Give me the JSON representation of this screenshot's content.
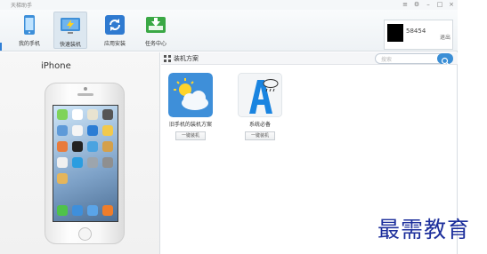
{
  "window": {
    "title": "天梯助手",
    "controls": [
      "≡",
      "⚙",
      "–",
      "□",
      "×"
    ]
  },
  "toolbar": {
    "items": [
      {
        "label": "我的手机",
        "icon": "phone-icon"
      },
      {
        "label": "快速装机",
        "icon": "lightning-icon"
      },
      {
        "label": "应用安装",
        "icon": "refresh-icon"
      },
      {
        "label": "任务中心",
        "icon": "download-icon"
      }
    ],
    "active_index": 1
  },
  "user": {
    "name": "58454",
    "logout": "退出"
  },
  "device": {
    "name": "iPhone"
  },
  "content": {
    "title": "装机方案",
    "search": {
      "placeholder": "搜索"
    },
    "cards": [
      {
        "title": "旧手机的装机方案",
        "button": "一键装机",
        "icon": "weather-icon"
      },
      {
        "title": "系统必备",
        "button": "一键装机",
        "icon": "letter-a-icon"
      }
    ]
  },
  "watermark": "最需教育",
  "colors": {
    "accent": "#3a8ed6",
    "watermark": "#1d2f9c"
  }
}
